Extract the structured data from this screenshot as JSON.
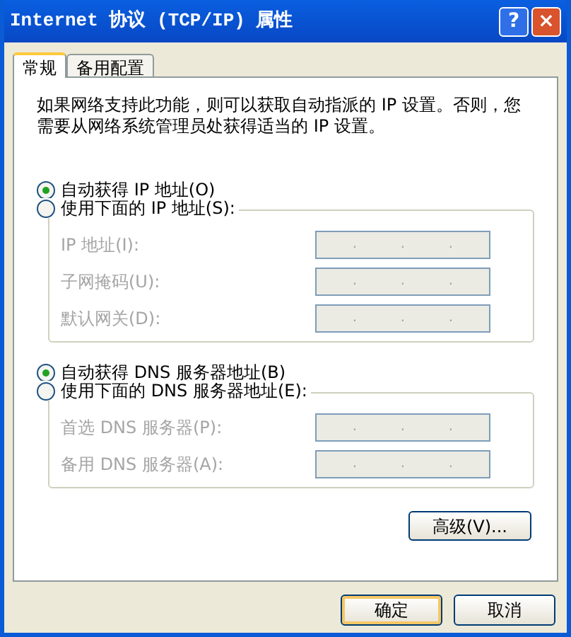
{
  "window": {
    "title": "Internet 协议 (TCP/IP) 属性",
    "buttons": [
      "?",
      "×"
    ]
  },
  "tabs": [
    {
      "label": "常规",
      "selected": true
    },
    {
      "label": "备用配置",
      "selected": false
    }
  ],
  "description": "如果网络支持此功能，则可以获取自动指派的 IP 设置。否则，您需要从网络系统管理员处获得适当的 IP 设置。",
  "ip_section": {
    "options": [
      {
        "label": "自动获得 IP 地址(O)",
        "selected": true
      },
      {
        "label": "使用下面的 IP 地址(S):",
        "selected": false
      }
    ],
    "fields": [
      {
        "label": "IP 地址(I):",
        "disabled": true,
        "separators": [
          ".",
          ".",
          "."
        ]
      },
      {
        "label": "子网掩码(U):",
        "disabled": true,
        "separators": [
          ".",
          ".",
          "."
        ]
      },
      {
        "label": "默认网关(D):",
        "disabled": true,
        "separators": [
          ".",
          ".",
          "."
        ]
      }
    ]
  },
  "dns_section": {
    "options": [
      {
        "label": "自动获得 DNS 服务器地址(B)",
        "selected": true
      },
      {
        "label": "使用下面的 DNS 服务器地址(E):",
        "selected": false
      }
    ],
    "fields": [
      {
        "label": "首选 DNS 服务器(P):",
        "disabled": true,
        "separators": [
          ".",
          ".",
          "."
        ]
      },
      {
        "label": "备用 DNS 服务器(A):",
        "disabled": true,
        "separators": [
          ".",
          ".",
          "."
        ]
      }
    ]
  },
  "advanced_button": "高级(V)...",
  "buttons": [
    {
      "label": "确定",
      "default": true
    },
    {
      "label": "取消",
      "default": false
    }
  ]
}
